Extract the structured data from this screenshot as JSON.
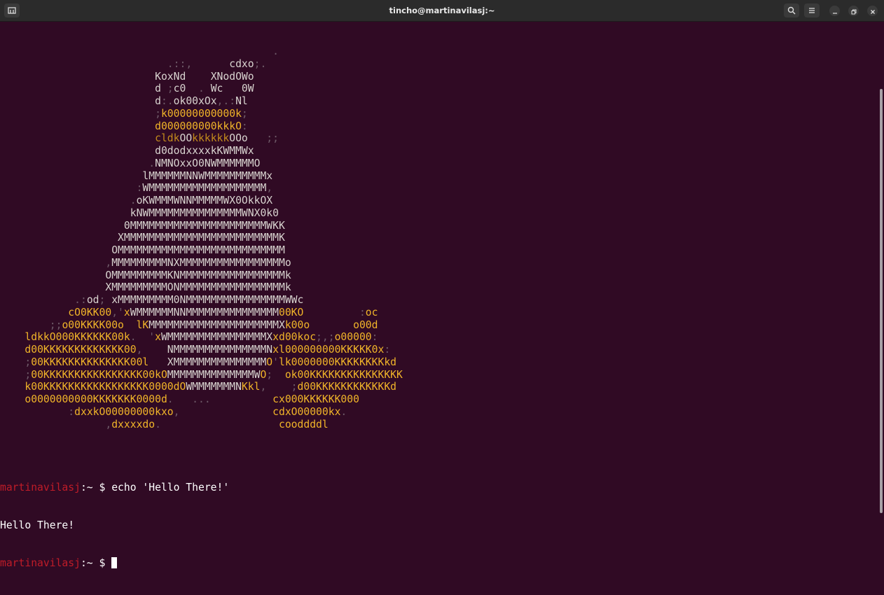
{
  "window": {
    "title": "tincho@martinavilasj:~",
    "buttons": {
      "search_icon": "search-icon",
      "menu_icon": "hamburger-menu-icon",
      "minimize_icon": "minimize-icon",
      "maximize_icon": "restore-icon",
      "close_icon": "close-icon",
      "newtab_icon": "new-tab-icon"
    }
  },
  "terminal": {
    "ascii_art": [
      "                                            .",
      "                           .::,      cdxo;.",
      "                         KoxNd    XNodOWo",
      "                         d ;c0  . Wc   0W",
      "                         d:.ok00xOx,.:Nl",
      "                         ;k00000000000k;",
      "                         d000000000kkkO:",
      "                         cldkOOkkkkkkOOo   ;;",
      "                         d0dodxxxxkKWMMWx",
      "                        .NMNOxxO0NWMMMMMMO",
      "                       lMMMMMMNNWMMMMMMMMMMx",
      "                      :WMMMMMMMMMMMMMMMMMMM,",
      "                     .oKWMMMWNNMMMMMWX0OkkOX",
      "                     kNWMMMMMMMMMMMMMMMWNX0k0",
      "                    0MMMMMMMMMMMMMMMMMMMMMMWKK",
      "                   XMMMMMMMMMMMMMMMMMMMMMMMMMK",
      "                  OMMMMMMMMMMMMMMMMMMMMMMMMMMM",
      "                 ,MMMMMMMMMNXMMMMMMMMMMMMMMMMMo",
      "                 OMMMMMMMMMKNMMMMMMMMMMMMMMMMMk",
      "                 XMMMMMMMMMONMMMMMMMMMMMMMMMMMk",
      "            .:od; xMMMMMMMMM0NMMMMMMMMMMMMMMMMWWc",
      "           cO0KK00,'xWMMMMMMNNMMMMMMMMMMMMMMM00KO         :oc",
      "        ;;o00KKKK00o  lKMMMMMMMMMMMMMMMMMMMMMXk00o       o00d",
      "    ldkkO000KKKKKK00k.  'xWMMMMMMMMMMMMMMMMXxd00koc;,;o00000:",
      "    d00KKKKKKKKKKKKK00,    NMMMMMMMMMMMMMMMNxl000000000KKKKK0x:",
      "    ;00KKKKKKKKKKKKKK00l   XMMMMMMMMMMMMMMMO'lk0000000KKKKKKKKkd",
      "    ;00KKKKKKKKKKKKKKKK00kOMMMMMMMMMMMMMMWO;  ok00KKKKKKKKKKKKKKK",
      "    k00KKKKKKKKKKKKKKKKK0000dOWMMMMMMMNKkl,    ;d00KKKKKKKKKKKKd",
      "    o0000000000KKKKKKK0000d.   ...          cx000KKKKKK000",
      "           :dxxkO00000000kxo,               cdxO00000kx.",
      "                 ,dxxxxdo.                   cooddddl"
    ],
    "command_line": {
      "user": "martinavilasj",
      "path": ":~ $ ",
      "command": "echo 'Hello There!'"
    },
    "output": "Hello There!",
    "prompt_line": {
      "user": "martinavilasj",
      "path": ":~ $ "
    }
  }
}
